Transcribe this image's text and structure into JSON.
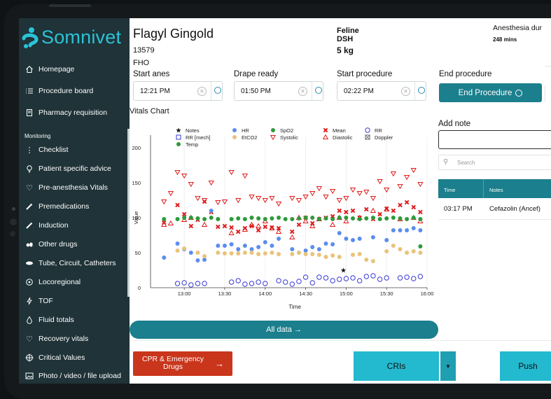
{
  "app": {
    "logo_text": "Somnivet",
    "brand_color": "#2bc3d7",
    "accent_color": "#1b7f8d"
  },
  "sidebar": {
    "items": [
      {
        "label": "Homepage",
        "icon": "home-icon"
      },
      {
        "label": "Procedure board",
        "icon": "list-icon"
      },
      {
        "label": "Pharmacy requisition",
        "icon": "document-icon"
      }
    ],
    "section_label": "Monitoring",
    "monitoring_items": [
      {
        "label": "Checklist",
        "icon": "checklist-icon"
      },
      {
        "label": "Patient specific advice",
        "icon": "lightbulb-icon"
      },
      {
        "label": "Pre-anesthesia Vitals",
        "icon": "heart-icon"
      },
      {
        "label": "Premedications",
        "icon": "syringe-icon"
      },
      {
        "label": "Induction",
        "icon": "syringe-icon"
      },
      {
        "label": "Other drugs",
        "icon": "pills-icon"
      },
      {
        "label": "Tube, Circuit, Catheters",
        "icon": "tube-icon"
      },
      {
        "label": "Locoregional",
        "icon": "target-icon"
      },
      {
        "label": "TOF",
        "icon": "lightning-icon"
      },
      {
        "label": "Fluid totals",
        "icon": "drop-icon"
      },
      {
        "label": "Recovery vitals",
        "icon": "heart-icon"
      },
      {
        "label": "Critical Values",
        "icon": "crosshair-icon"
      },
      {
        "label": "Photo / video / file upload",
        "icon": "image-icon"
      }
    ]
  },
  "patient": {
    "name": "Flagyl Gingold",
    "id": "13579",
    "procedure": "FHO",
    "species": "Feline",
    "breed": "DSH",
    "weight": "5 kg",
    "anesthesia_label": "Anesthesia dur",
    "anesthesia_duration": "248 mins"
  },
  "timeline": {
    "start_anes": {
      "label": "Start anes",
      "value": "12:21 PM"
    },
    "drape_ready": {
      "label": "Drape ready",
      "value": "01:50 PM"
    },
    "start_procedure": {
      "label": "Start procedure",
      "value": "02:22 PM"
    },
    "end_procedure": {
      "label": "End procedure",
      "button": "End Procedure"
    }
  },
  "vitals": {
    "title": "Vitals Chart",
    "all_data_label": "All data →"
  },
  "chart_data": {
    "type": "scatter",
    "xlabel": "Time",
    "ylabel": "Value",
    "ylim": [
      0,
      200
    ],
    "yticks": [
      0,
      50,
      100,
      150,
      200
    ],
    "xticks": [
      "13:00",
      "13:30",
      "14:00",
      "14:30",
      "15:00",
      "15:30",
      "16:00"
    ],
    "xlim_minutes": [
      -25,
      180
    ],
    "legend": [
      {
        "name": "Notes",
        "marker": "star",
        "color": "#111111"
      },
      {
        "name": "HR",
        "marker": "dot",
        "color": "#5b8def"
      },
      {
        "name": "SpO2",
        "marker": "dot",
        "color": "#2e9a3b"
      },
      {
        "name": "Mean",
        "marker": "x",
        "color": "#e01b1b"
      },
      {
        "name": "RR",
        "marker": "circle",
        "color": "#3a3ad6"
      },
      {
        "name": "RR [mech]",
        "marker": "square",
        "color": "#3a3ad6"
      },
      {
        "name": "EtCO2",
        "marker": "dot",
        "color": "#e8c37a"
      },
      {
        "name": "Systolic",
        "marker": "tri-down",
        "color": "#e01b1b"
      },
      {
        "name": "Diastolic",
        "marker": "tri-up",
        "color": "#e01b1b"
      },
      {
        "name": "Doppler",
        "marker": "square-x",
        "color": "#555555"
      },
      {
        "name": "Temp",
        "marker": "dot",
        "color": "#2e9a3b"
      }
    ],
    "series": [
      {
        "name": "Systolic",
        "x": [
          -15,
          -10,
          -5,
          0,
          5,
          10,
          15,
          20,
          25,
          30,
          35,
          40,
          45,
          50,
          55,
          60,
          65,
          70,
          80,
          85,
          90,
          95,
          100,
          105,
          110,
          115,
          120,
          125,
          130,
          135,
          140,
          145,
          150,
          155,
          160,
          165,
          170,
          175
        ],
        "y": [
          123,
          135,
          165,
          160,
          148,
          128,
          125,
          150,
          122,
          123,
          165,
          125,
          160,
          130,
          128,
          125,
          128,
          120,
          128,
          125,
          130,
          135,
          142,
          130,
          138,
          125,
          128,
          140,
          135,
          137,
          128,
          152,
          140,
          163,
          145,
          158,
          168,
          148
        ]
      },
      {
        "name": "Diastolic",
        "x": [
          -15,
          -10,
          0,
          5,
          15,
          35,
          45,
          50,
          55,
          60,
          65,
          70,
          80,
          85,
          90,
          95,
          100,
          110,
          115,
          120,
          130,
          140,
          150,
          160,
          170,
          175
        ],
        "y": [
          90,
          92,
          97,
          100,
          90,
          78,
          83,
          90,
          88,
          95,
          85,
          80,
          72,
          100,
          95,
          88,
          98,
          90,
          100,
          95,
          100,
          110,
          112,
          98,
          100,
          95
        ]
      },
      {
        "name": "Mean",
        "x": [
          -15,
          -5,
          0,
          5,
          10,
          15,
          20,
          25,
          30,
          35,
          40,
          45,
          50,
          55,
          60,
          65,
          70,
          80,
          85,
          90,
          95,
          100,
          105,
          110,
          115,
          120,
          125,
          130,
          135,
          140,
          145,
          150,
          155,
          160,
          165,
          170,
          175
        ],
        "y": [
          93,
          118,
          105,
          88,
          97,
          123,
          108,
          87,
          88,
          86,
          80,
          85,
          88,
          82,
          87,
          86,
          85,
          80,
          90,
          100,
          92,
          98,
          100,
          102,
          110,
          108,
          110,
          100,
          112,
          98,
          105,
          113,
          110,
          118,
          122,
          115,
          108
        ]
      },
      {
        "name": "HR",
        "x": [
          -15,
          -5,
          0,
          5,
          10,
          15,
          20,
          25,
          30,
          35,
          40,
          45,
          50,
          55,
          60,
          65,
          70,
          80,
          85,
          90,
          95,
          100,
          105,
          110,
          115,
          120,
          125,
          130,
          140,
          150,
          155,
          160,
          165,
          170,
          175
        ],
        "y": [
          43,
          63,
          55,
          50,
          39,
          40,
          110,
          60,
          60,
          62,
          55,
          60,
          55,
          58,
          65,
          60,
          70,
          55,
          50,
          53,
          58,
          55,
          63,
          62,
          78,
          70,
          68,
          70,
          72,
          68,
          82,
          82,
          82,
          85,
          82
        ]
      },
      {
        "name": "SpO2",
        "x": [
          -15,
          -5,
          0,
          5,
          10,
          15,
          20,
          25,
          35,
          40,
          45,
          50,
          55,
          60,
          65,
          70,
          75,
          80,
          85,
          90,
          95,
          100,
          105,
          110,
          115,
          120,
          125,
          130,
          135,
          140,
          145,
          150,
          155,
          160,
          165,
          170,
          175
        ],
        "y": [
          98,
          98,
          100,
          100,
          99,
          98,
          100,
          98,
          98,
          99,
          98,
          100,
          99,
          98,
          99,
          100,
          98,
          98,
          99,
          100,
          100,
          98,
          99,
          98,
          100,
          100,
          99,
          98,
          99,
          100,
          98,
          99,
          100,
          99,
          98,
          100,
          98
        ]
      },
      {
        "name": "EtCO2",
        "x": [
          -5,
          0,
          10,
          15,
          25,
          30,
          35,
          40,
          45,
          50,
          55,
          60,
          65,
          70,
          80,
          85,
          90,
          95,
          100,
          105,
          110,
          115,
          125,
          130,
          135,
          140,
          150,
          155,
          160,
          165,
          170,
          175
        ],
        "y": [
          53,
          56,
          50,
          45,
          50,
          49,
          49,
          49,
          50,
          50,
          48,
          49,
          50,
          48,
          48,
          50,
          48,
          48,
          47,
          44,
          46,
          44,
          47,
          48,
          40,
          38,
          52,
          60,
          55,
          50,
          52,
          50
        ]
      },
      {
        "name": "RR",
        "x": [
          -5,
          0,
          5,
          10,
          15,
          35,
          40,
          45,
          50,
          55,
          60,
          70,
          75,
          80,
          85,
          90,
          95,
          100,
          105,
          110,
          115,
          120,
          125,
          130,
          135,
          140,
          145,
          150,
          160,
          165,
          170,
          175
        ],
        "y": [
          6,
          7,
          4,
          6,
          6,
          8,
          10,
          5,
          6,
          8,
          6,
          10,
          8,
          5,
          9,
          15,
          7,
          15,
          14,
          10,
          12,
          13,
          14,
          10,
          16,
          17,
          12,
          14,
          14,
          15,
          13,
          16
        ]
      },
      {
        "name": "Temp",
        "x": [
          175
        ],
        "y": [
          59
        ]
      },
      {
        "name": "Notes",
        "x": [
          118
        ],
        "y": [
          25
        ]
      }
    ]
  },
  "notes": {
    "title": "Add note",
    "search_placeholder": "Search",
    "columns": [
      "Time",
      "Notes"
    ],
    "rows": [
      {
        "time": "03:17 PM",
        "note": "Cefazolin (Ancef)"
      }
    ]
  },
  "actions": {
    "cpr": "CPR & Emergency Drugs",
    "cris": "CRIs",
    "push": "Push"
  }
}
